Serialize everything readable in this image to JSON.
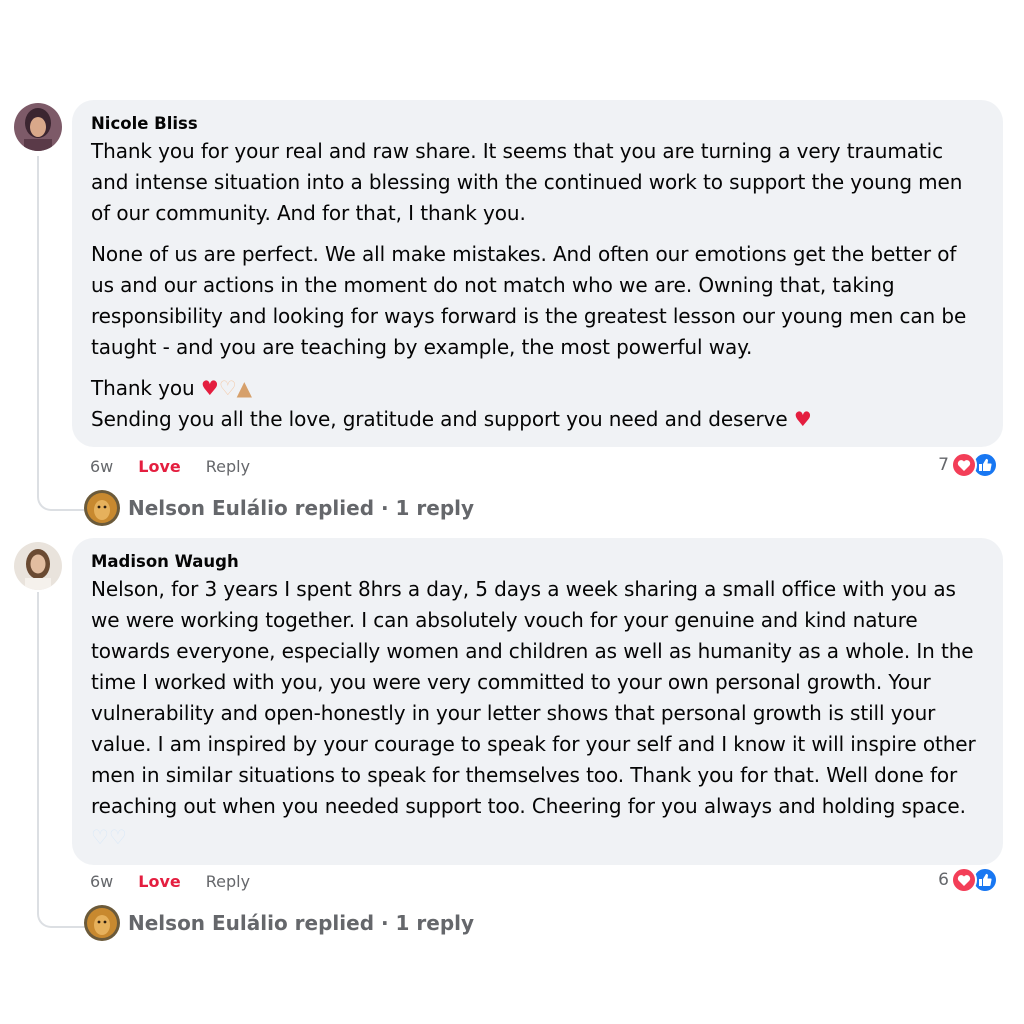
{
  "comments": [
    {
      "author": "Nicole Bliss",
      "paragraphs": [
        "Thank you for your real and raw share. It seems that you are turning a very traumatic and intense situation into a blessing with the continued work to support the young men of our community. And for that, I thank you.",
        "None of us are perfect. We all make mistakes. And often our emotions get the better of us and our actions in the moment do not match who we are. Owning that, taking responsibility and looking for ways forward is the greatest lesson our young men can be taught - and you are teaching by example, the most powerful way."
      ],
      "closing_line_1": "Thank you",
      "closing_line_2": "Sending you all the love, gratitude and support you need and deserve",
      "time": "6w",
      "love_label": "Love",
      "reply_label": "Reply",
      "reaction_count": "7",
      "replied_text": "Nelson Eulálio replied · 1 reply"
    },
    {
      "author": "Madison Waugh",
      "paragraphs": [
        "Nelson, for 3 years I spent 8hrs a day, 5 days a week sharing a small office with you as we were working together. I can absolutely vouch for your genuine and kind nature towards everyone, especially women and children as well as humanity as a whole. In the time I worked with you, you were very committed to your own personal growth. Your vulnerability and open-honestly in your letter shows that personal growth is still your value. I am inspired by your courage to speak for your self and I know it will inspire other men in similar situations to speak for themselves too. Thank you for that. Well done for reaching out when you needed support too. Cheering for you always and holding space."
      ],
      "time": "6w",
      "love_label": "Love",
      "reply_label": "Reply",
      "reaction_count": "6",
      "replied_text": "Nelson Eulálio replied · 1 reply"
    }
  ],
  "colors": {
    "bubble": "#f0f2f5",
    "love": "#e41e3f",
    "muted": "#65676b",
    "like_blue": "#1877f2",
    "heart_red": "#f33e58"
  },
  "icons": {
    "emoji_heart": "red-heart-icon",
    "emoji_heart_hands": "heart-hands-icon",
    "emoji_praying": "folded-hands-icon",
    "emoji_white_heart": "white-heart-icon",
    "reaction_love": "love-reaction-icon",
    "reaction_like": "like-reaction-icon"
  }
}
